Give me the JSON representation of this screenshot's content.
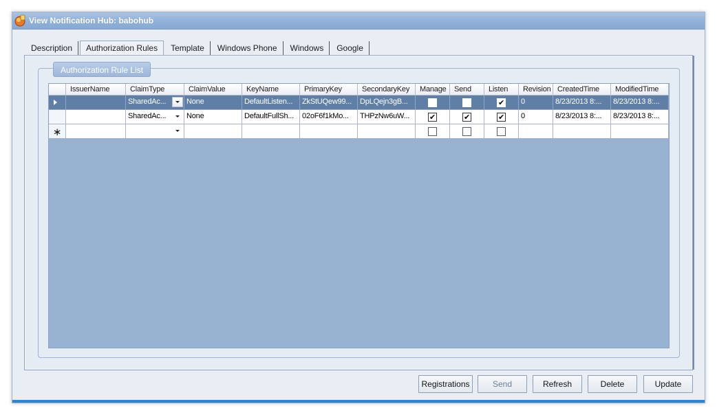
{
  "window": {
    "title": "View Notification Hub: babohub",
    "accent": "#2e84d1"
  },
  "tabs": [
    {
      "label": "Description",
      "active": false
    },
    {
      "label": "Authorization Rules",
      "active": true
    },
    {
      "label": "Template",
      "active": false
    },
    {
      "label": "Windows Phone",
      "active": false
    },
    {
      "label": "Windows",
      "active": false
    },
    {
      "label": "Google",
      "active": false
    }
  ],
  "group": {
    "caption": "Authorization Rule List"
  },
  "grid": {
    "columns": [
      "IssuerName",
      "ClaimType",
      "ClaimValue",
      "KeyName",
      "PrimaryKey",
      "SecondaryKey",
      "Manage",
      "Send",
      "Listen",
      "Revision",
      "CreatedTime",
      "ModifiedTime"
    ],
    "rows": [
      {
        "selected": true,
        "issuer_name": "",
        "claim_type": "SharedAc...",
        "claim_value": "None",
        "key_name": "DefaultListen...",
        "primary_key": "ZkStUQew99...",
        "secondary_key": "DpLQejn3gB...",
        "manage": false,
        "send": false,
        "listen": true,
        "revision": "0",
        "created_time": "8/23/2013 8:...",
        "modified_time": "8/23/2013 8:..."
      },
      {
        "selected": false,
        "issuer_name": "",
        "claim_type": "SharedAc...",
        "claim_value": "None",
        "key_name": "DefaultFullSh...",
        "primary_key": "02oF6f1kMo...",
        "secondary_key": "THPzNw6uW...",
        "manage": true,
        "send": true,
        "listen": true,
        "revision": "0",
        "created_time": "8/23/2013 8:...",
        "modified_time": "8/23/2013 8:..."
      }
    ],
    "new_row_marker": "∗",
    "check_mark": "✔"
  },
  "buttons": {
    "registrations": "Registrations",
    "send": "Send",
    "refresh": "Refresh",
    "delete": "Delete",
    "update": "Update"
  }
}
